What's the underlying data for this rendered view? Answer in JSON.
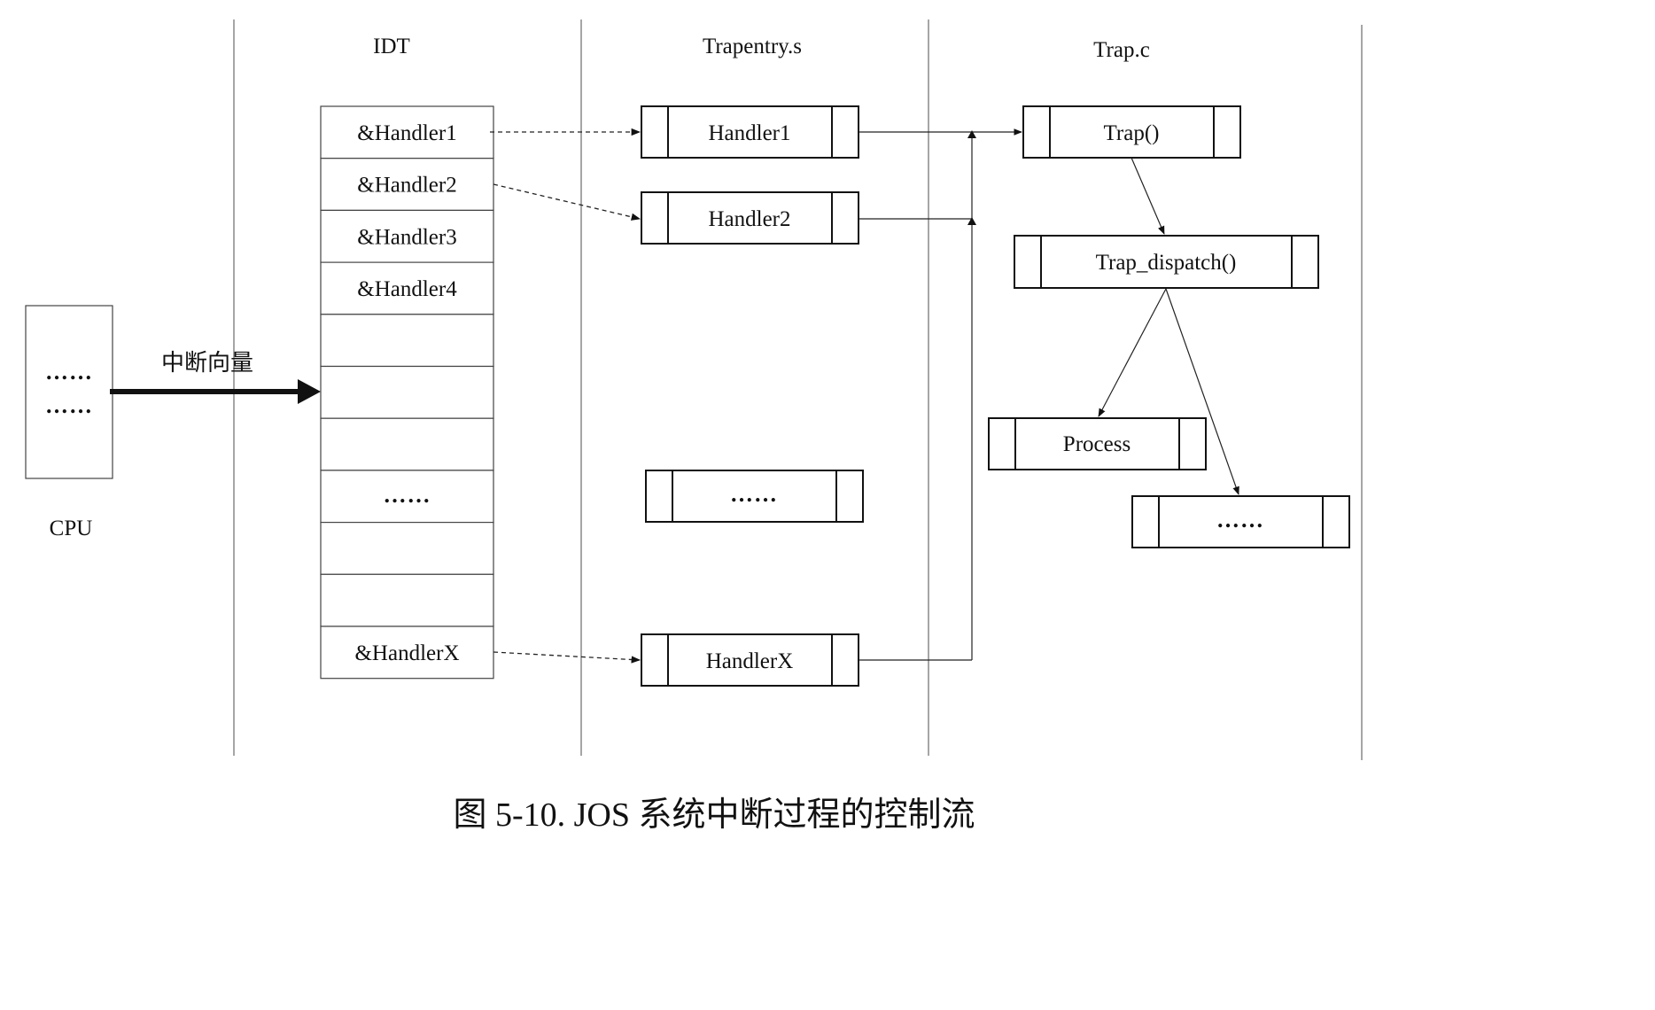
{
  "columns": {
    "idt": "IDT",
    "trapentry": "Trapentry.s",
    "trap": "Trap.c"
  },
  "cpu": {
    "label": "CPU",
    "dots_top": "……",
    "dots_bottom": "……"
  },
  "vector_label": "中断向量",
  "idt_rows": [
    "&Handler1",
    "&Handler2",
    "&Handler3",
    "&Handler4",
    "",
    "",
    "",
    "……",
    "",
    "",
    "&HandlerX"
  ],
  "handlers": {
    "h1": "Handler1",
    "h2": "Handler2",
    "dots": "……",
    "hx": "HandlerX"
  },
  "trap_funcs": {
    "trap": "Trap()",
    "dispatch": "Trap_dispatch()",
    "process": "Process",
    "dots": "……"
  },
  "caption": "图 5-10. JOS 系统中断过程的控制流"
}
